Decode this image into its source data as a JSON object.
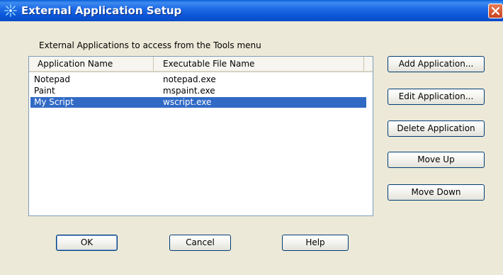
{
  "window": {
    "title": "External Application Setup",
    "icon": "sparkle-app-icon",
    "close_icon": "close-icon"
  },
  "main": {
    "list_label": "External Applications to access from the Tools menu",
    "columns": [
      "Application Name",
      "Executable File Name"
    ],
    "rows": [
      {
        "name": "Notepad",
        "exe": "notepad.exe",
        "selected": false
      },
      {
        "name": "Paint",
        "exe": "mspaint.exe",
        "selected": false
      },
      {
        "name": "My Script",
        "exe": "wscript.exe",
        "selected": true
      }
    ]
  },
  "side_buttons": {
    "add": "Add Application...",
    "edit": "Edit Application...",
    "delete": "Delete Application",
    "move_up": "Move Up",
    "move_down": "Move Down"
  },
  "bottom_buttons": {
    "ok": "OK",
    "cancel": "Cancel",
    "help": "Help"
  },
  "colors": {
    "title_bar": "#0A5FD8",
    "selection": "#316AC5",
    "dialog_bg": "#ECE9D8",
    "close_button": "#D8582F"
  }
}
